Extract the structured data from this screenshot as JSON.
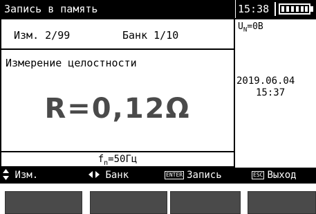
{
  "header": {
    "title": "Запись в память",
    "clock": "15:38",
    "battery_level": 1.0
  },
  "main": {
    "measurement": "Изм. 2/99",
    "bank": "Банк 1/10",
    "mode": "Измерение целостности",
    "result": "R=0,12Ω",
    "frequency": "fn=50Гц"
  },
  "side": {
    "voltage": "UN=0В",
    "date": "2019.06.04",
    "time": "15:37"
  },
  "footer": {
    "meas_nav": "Изм.",
    "bank_nav": "Банк",
    "enter_key": "ENTER",
    "enter_label": "Запись",
    "esc_key": "ESC",
    "esc_label": "Выход"
  }
}
